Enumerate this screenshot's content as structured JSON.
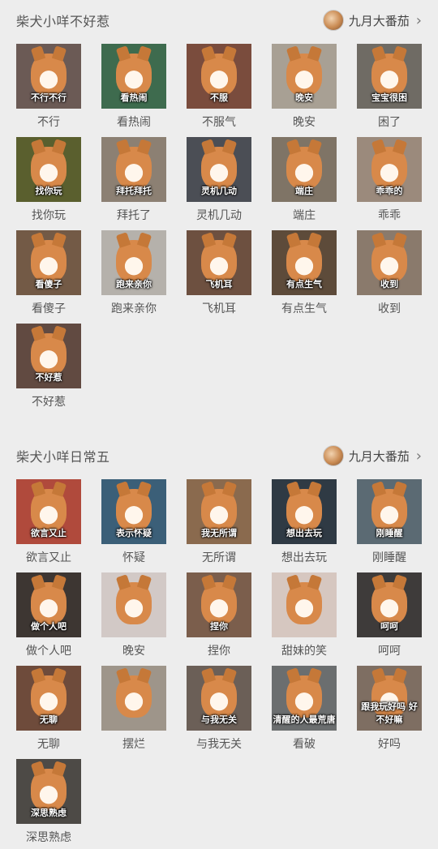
{
  "sections": [
    {
      "title": "柴犬小咩不好惹",
      "author": "九月大番茄",
      "items": [
        {
          "label": "不行",
          "caption": "不行不行",
          "bg": "#6b5a55"
        },
        {
          "label": "看热闹",
          "caption": "看热闹",
          "bg": "#3e6b4e"
        },
        {
          "label": "不服气",
          "caption": "不服",
          "bg": "#7a4c3d"
        },
        {
          "label": "晚安",
          "caption": "晚安",
          "bg": "#a8a094"
        },
        {
          "label": "困了",
          "caption": "宝宝很困",
          "bg": "#6f6b64"
        },
        {
          "label": "找你玩",
          "caption": "找你玩",
          "bg": "#5a5f2e"
        },
        {
          "label": "拜托了",
          "caption": "拜托拜托",
          "bg": "#8c8073"
        },
        {
          "label": "灵机几动",
          "caption": "灵机几动",
          "bg": "#4b4e55"
        },
        {
          "label": "端庄",
          "caption": "端庄",
          "bg": "#7f7466"
        },
        {
          "label": "乖乖",
          "caption": "乖乖的",
          "bg": "#9b8a7c"
        },
        {
          "label": "看傻子",
          "caption": "看傻子",
          "bg": "#735a46"
        },
        {
          "label": "跑来亲你",
          "caption": "跑来亲你",
          "bg": "#b5b1ab"
        },
        {
          "label": "飞机耳",
          "caption": "飞机耳",
          "bg": "#6d5040"
        },
        {
          "label": "有点生气",
          "caption": "有点生气",
          "bg": "#5d4b3a"
        },
        {
          "label": "收到",
          "caption": "收到",
          "bg": "#8a7a6c"
        },
        {
          "label": "不好惹",
          "caption": "不好惹",
          "bg": "#614a41"
        }
      ]
    },
    {
      "title": "柴犬小咩日常五",
      "author": "九月大番茄",
      "items": [
        {
          "label": "欲言又止",
          "caption": "欲言又止",
          "bg": "#b04a3c"
        },
        {
          "label": "怀疑",
          "caption": "表示怀疑",
          "bg": "#3b5f78"
        },
        {
          "label": "无所谓",
          "caption": "我无所谓",
          "bg": "#8a6a4e"
        },
        {
          "label": "想出去玩",
          "caption": "想出去玩",
          "bg": "#2f3a44"
        },
        {
          "label": "刚睡醒",
          "caption": "刚睡醒",
          "bg": "#5b6a73"
        },
        {
          "label": "做个人吧",
          "caption": "做个人吧",
          "bg": "#3d3632"
        },
        {
          "label": "晚安",
          "caption": "",
          "bg": "#d2c9c6"
        },
        {
          "label": "捏你",
          "caption": "捏你",
          "bg": "#7b5e4c"
        },
        {
          "label": "甜妹的笑",
          "caption": "",
          "bg": "#d6c7c0"
        },
        {
          "label": "呵呵",
          "caption": "呵呵",
          "bg": "#3e3b3a"
        },
        {
          "label": "无聊",
          "caption": "无聊",
          "bg": "#6e4b3b"
        },
        {
          "label": "摆烂",
          "caption": "",
          "bg": "#9e958a"
        },
        {
          "label": "与我无关",
          "caption": "与我无关",
          "bg": "#6b5f57"
        },
        {
          "label": "看破",
          "caption": "清醒的人最荒唐",
          "bg": "#6b6e6f"
        },
        {
          "label": "好吗",
          "caption": "跟我玩好吗 好不好嘛",
          "bg": "#7e6e62"
        },
        {
          "label": "深思熟虑",
          "caption": "深思熟虑",
          "bg": "#4d4a46"
        }
      ]
    }
  ]
}
